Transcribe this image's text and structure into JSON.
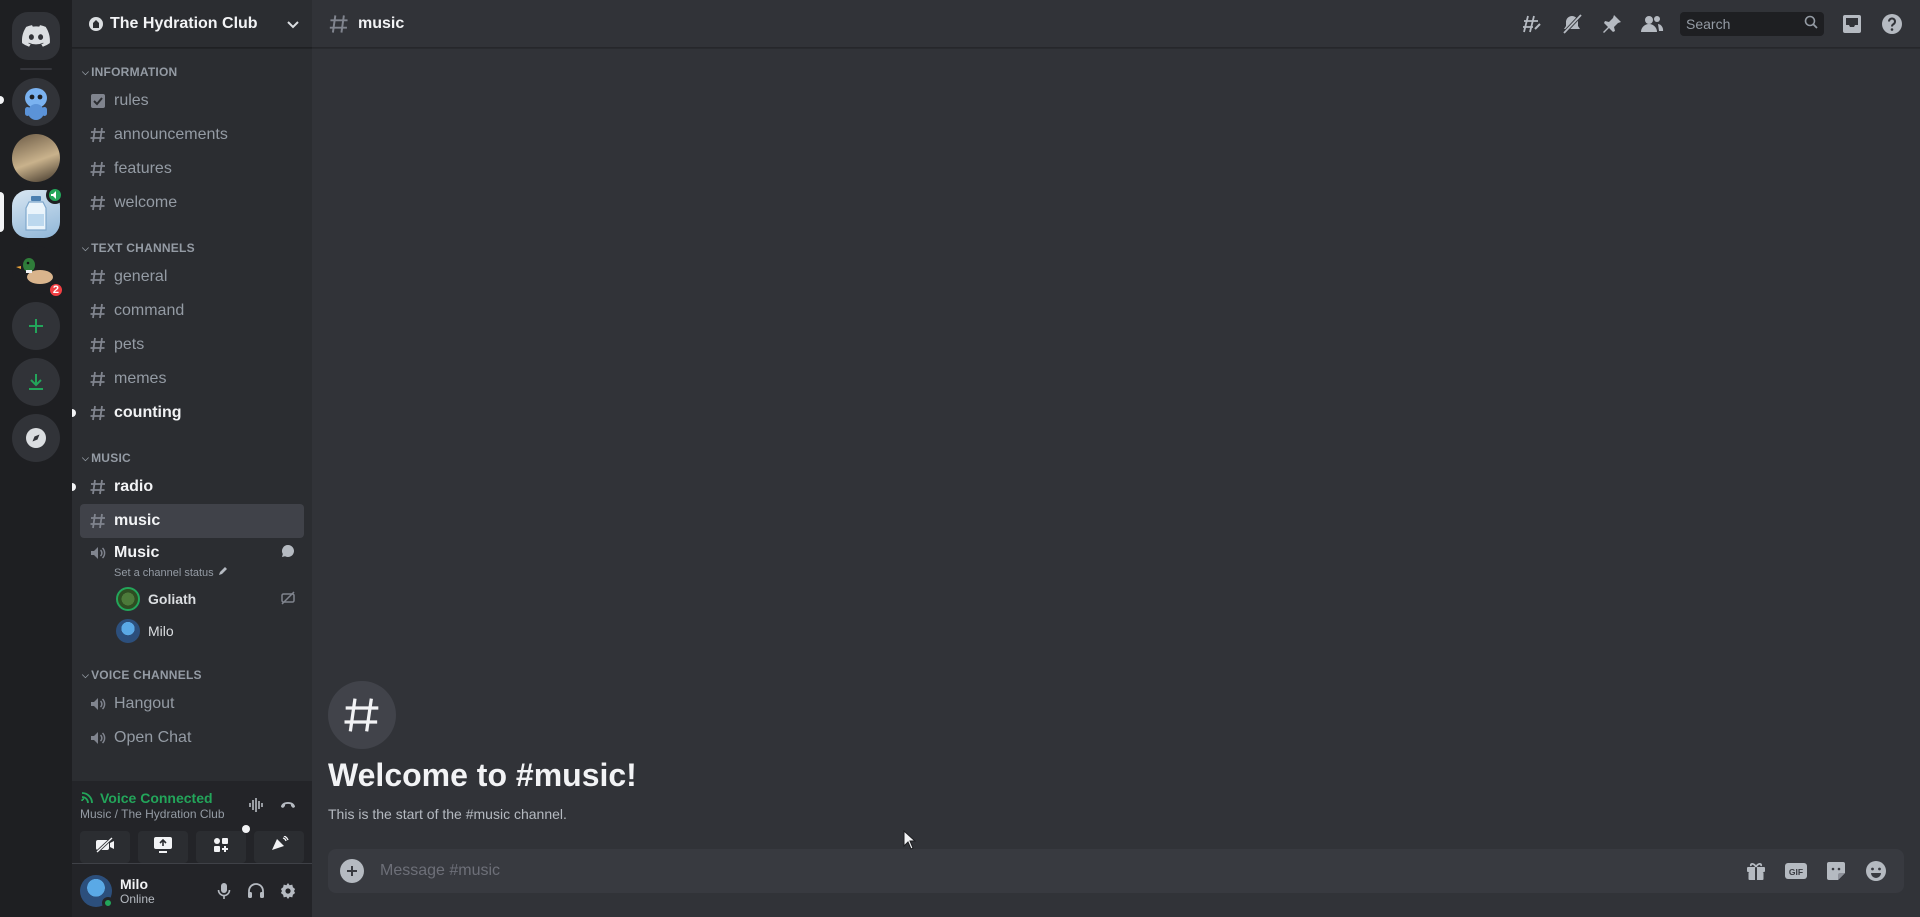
{
  "server_rail": {
    "servers": [
      {
        "name": "direct-messages"
      },
      {
        "name": "server-mascot"
      },
      {
        "name": "server-photo"
      },
      {
        "name": "server-hydration-club"
      },
      {
        "name": "server-duck"
      }
    ],
    "duck_badge": "2"
  },
  "guild": {
    "name": "The Hydration Club"
  },
  "categories": {
    "information": "INFORMATION",
    "text": "TEXT CHANNELS",
    "music": "MUSIC",
    "voice": "VOICE CHANNELS"
  },
  "channels": {
    "information": [
      "rules",
      "announcements",
      "features",
      "welcome"
    ],
    "text": [
      "general",
      "command",
      "pets",
      "memes",
      "counting"
    ],
    "music": [
      "radio",
      "music"
    ],
    "voice": [
      "Hangout",
      "Open Chat"
    ]
  },
  "voice_channel": {
    "name": "Music",
    "status_prompt": "Set a channel status",
    "users": [
      "Goliath",
      "Milo"
    ]
  },
  "voice_panel": {
    "status": "Voice Connected",
    "location": "Music / The Hydration Club"
  },
  "user": {
    "name": "Milo",
    "status": "Online"
  },
  "topbar": {
    "channel": "music",
    "search_placeholder": "Search"
  },
  "welcome": {
    "title": "Welcome to #music!",
    "subtitle": "This is the start of the #music channel."
  },
  "composer": {
    "placeholder": "Message #music"
  },
  "colors": {
    "background": "#313338",
    "sidebar": "#2b2d31",
    "rail": "#1e1f22",
    "accent_green": "#23a55a",
    "badge_red": "#f23f43"
  }
}
